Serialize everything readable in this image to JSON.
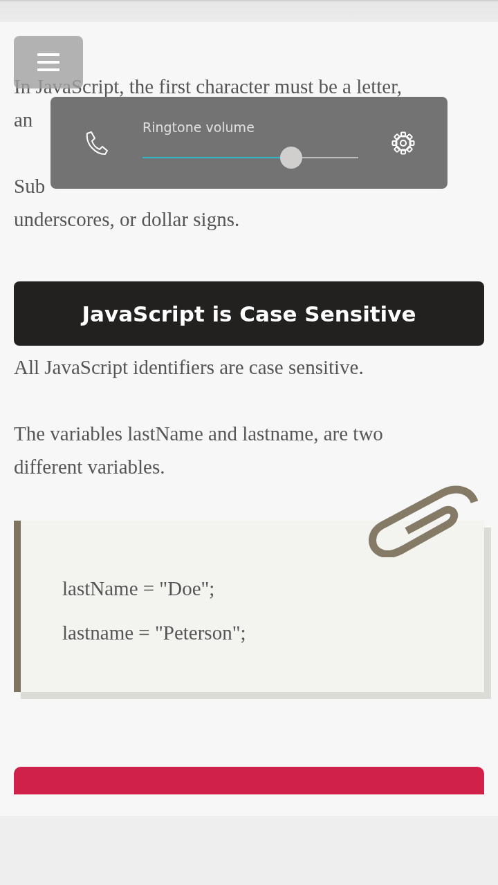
{
  "paragraphs_top": [
    {
      "lines": [
        "In JavaScript, the first character must be a letter,",
        "an"
      ]
    },
    {
      "lines": [
        "Sub",
        "underscores, or dollar signs."
      ]
    }
  ],
  "heading": "JavaScript is Case Sensitive",
  "paragraphs": [
    {
      "lines": [
        "All JavaScript identifiers are case sensitive."
      ]
    },
    {
      "lines": [
        "The variables lastName and lastname, are two",
        "different variables."
      ]
    }
  ],
  "code_lines": [
    "lastName = \"Doe\";",
    "lastname = \"Peterson\";"
  ],
  "volume_dialog": {
    "title": "Ringtone volume",
    "level": 0.69
  }
}
